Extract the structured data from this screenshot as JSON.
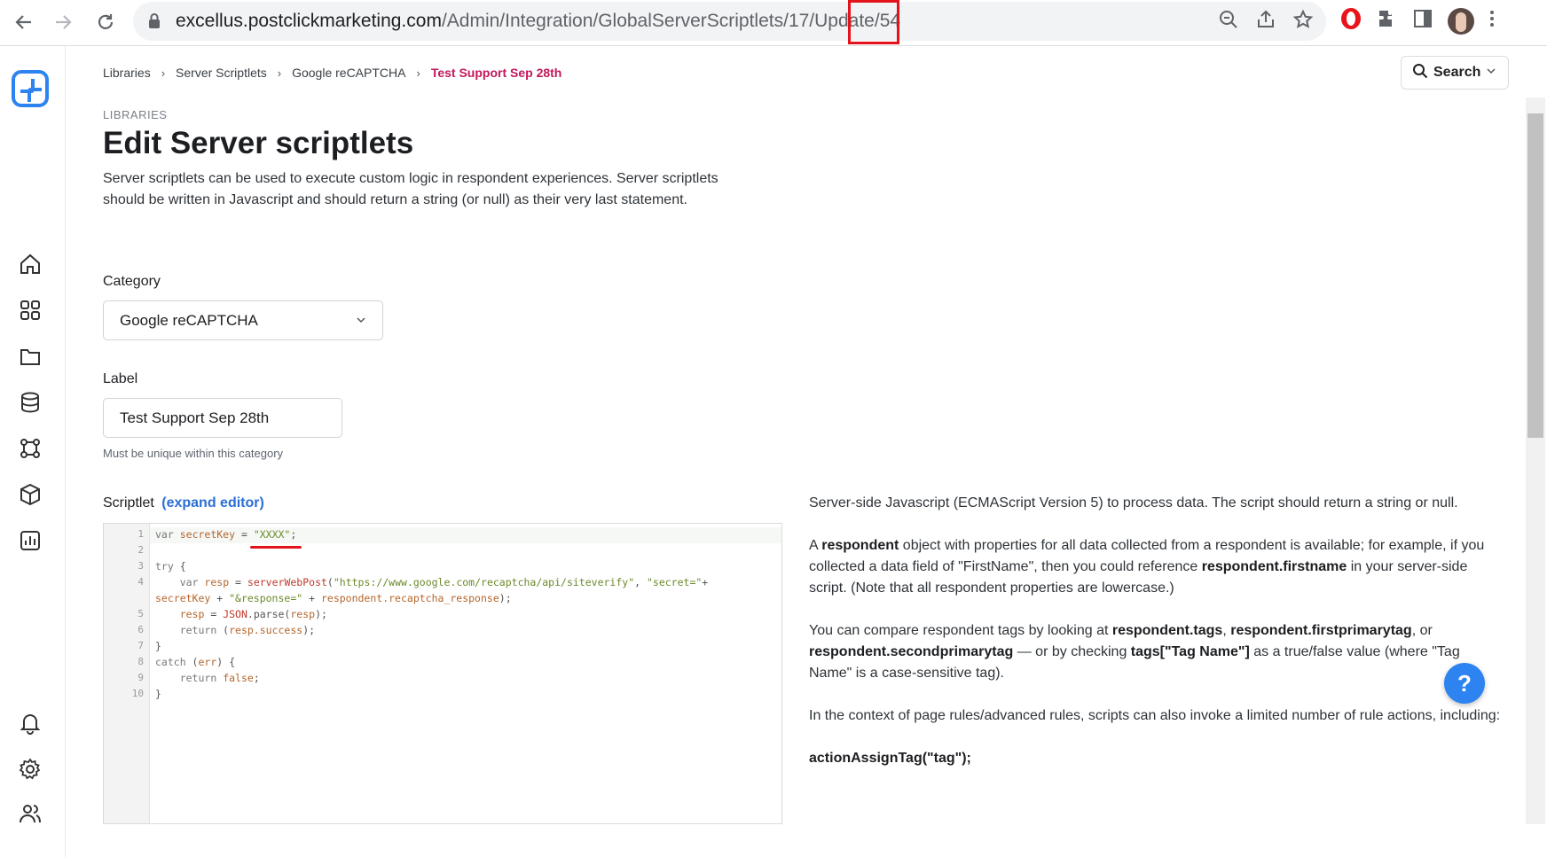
{
  "browser": {
    "url_host": "excellus.postclickmarketing.com",
    "url_path": "/Admin/Integration/GlobalServerScriptlets/17/Update/54"
  },
  "breadcrumb": {
    "items": [
      "Libraries",
      "Server Scriptlets",
      "Google reCAPTCHA"
    ],
    "current": "Test Support Sep 28th"
  },
  "header": {
    "search_label": "Search"
  },
  "page": {
    "eyebrow": "LIBRARIES",
    "title": "Edit Server scriptlets",
    "intro": "Server scriptlets can be used to execute custom logic in respondent experiences. Server scriptlets should be written in Javascript and should return a string (or null) as their very last statement."
  },
  "form": {
    "category_label": "Category",
    "category_value": "Google reCAPTCHA",
    "label_label": "Label",
    "label_value": "Test Support Sep 28th",
    "label_hint": "Must be unique within this category",
    "scriptlet_label": "Scriptlet",
    "expand_link": "(expand editor)"
  },
  "editor": {
    "line_numbers": [
      "1",
      "2",
      "3",
      "4",
      "",
      "5",
      "6",
      "7",
      "8",
      "9",
      "10"
    ]
  },
  "help": {
    "p1": "Server-side Javascript (ECMAScript Version 5) to process data. The script should return a string or null.",
    "p2_a": "A ",
    "p2_b": "respondent",
    "p2_c": " object with properties for all data collected from a respondent is available; for example, if you collected a data field of \"FirstName\", then you could reference ",
    "p2_d": "respondent.firstname",
    "p2_e": " in your server-side script. (Note that all respondent properties are lowercase.)",
    "p3_a": "You can compare respondent tags by looking at ",
    "p3_b": "respondent.tags",
    "p3_c": ", ",
    "p3_d": "respondent.firstprimarytag",
    "p3_e": ", or ",
    "p3_f": "respondent.secondprimarytag",
    "p3_g": " — or by checking ",
    "p3_h": "tags[\"Tag Name\"]",
    "p3_i": " as a true/false value (where \"Tag Name\" is a case-sensitive tag).",
    "p4": "In the context of page rules/advanced rules, scripts can also invoke a limited number of rule actions, including:",
    "p5": "actionAssignTag(\"tag\");"
  },
  "help_fab": "?",
  "colors": {
    "accent": "#2d84f0",
    "breadcrumb_current": "#c2185b",
    "highlight": "#e3131b"
  }
}
